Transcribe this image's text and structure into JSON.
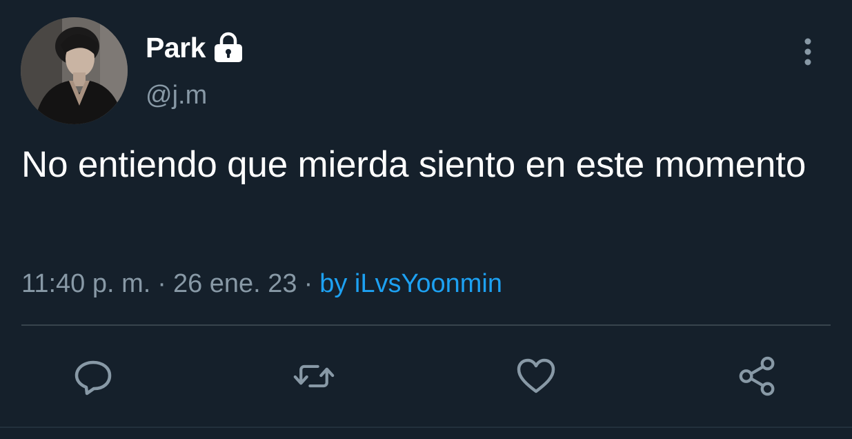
{
  "tweet": {
    "display_name": "Park",
    "handle": "@j.m",
    "text": "No entiendo que mierda siento en este momento",
    "time": "11:40 p. m.",
    "date": "26 ene. 23",
    "separator": "·",
    "source": "by iLvsYoonmin"
  },
  "icons": {
    "lock": "lock-icon",
    "more": "more-vertical-icon",
    "reply": "reply-icon",
    "retweet": "retweet-icon",
    "like": "heart-icon",
    "share": "share-icon"
  },
  "colors": {
    "background": "#15202b",
    "primary_text": "#ffffff",
    "secondary_text": "#8899a6",
    "accent": "#1da1f2",
    "divider": "#38444d"
  }
}
